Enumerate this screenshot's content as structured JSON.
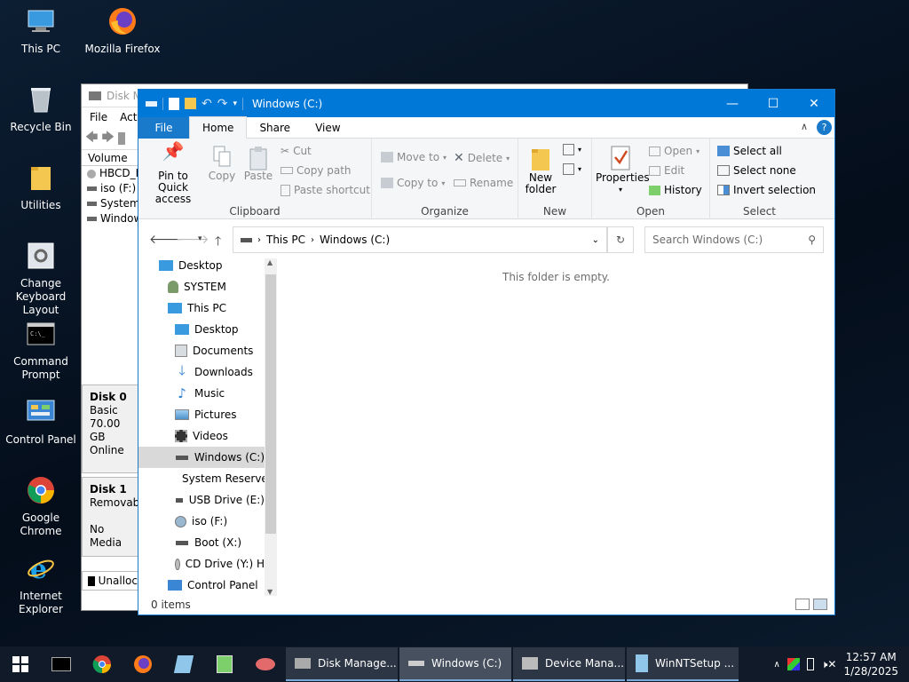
{
  "desktop": {
    "icons": [
      {
        "label": "This PC"
      },
      {
        "label": "Mozilla Firefox"
      },
      {
        "label": "Recycle Bin"
      },
      {
        "label": "Utilities"
      },
      {
        "label": "Change Keyboard Layout"
      },
      {
        "label": "Command Prompt"
      },
      {
        "label": "Control Panel"
      },
      {
        "label": "Google Chrome"
      },
      {
        "label": "Internet Explorer"
      }
    ]
  },
  "bg_window": {
    "title": "Disk Ma",
    "menu": [
      "File",
      "Acti"
    ],
    "column_header": "Volume",
    "volumes": [
      "HBCD_F",
      "iso (F:)",
      "System",
      "Window"
    ],
    "disk0": {
      "name": "Disk 0",
      "type": "Basic",
      "size": "70.00 GB",
      "status": "Online"
    },
    "disk1": {
      "name": "Disk 1",
      "type": "Removabl",
      "status": "No Media"
    },
    "unalloc": "Unalloc"
  },
  "explorer": {
    "title": "Windows (C:)",
    "tabs": {
      "file": "File",
      "home": "Home",
      "share": "Share",
      "view": "View"
    },
    "ribbon": {
      "clipboard": {
        "label": "Clipboard",
        "pin": "Pin to Quick access",
        "copy": "Copy",
        "paste": "Paste",
        "cut": "Cut",
        "copy_path": "Copy path",
        "paste_shortcut": "Paste shortcut"
      },
      "organize": {
        "label": "Organize",
        "move_to": "Move to",
        "copy_to": "Copy to",
        "delete": "Delete",
        "rename": "Rename"
      },
      "new": {
        "label": "New",
        "new_folder": "New folder"
      },
      "open": {
        "label": "Open",
        "properties": "Properties",
        "open": "Open",
        "edit": "Edit",
        "history": "History"
      },
      "select": {
        "label": "Select",
        "select_all": "Select all",
        "select_none": "Select none",
        "invert": "Invert selection"
      }
    },
    "address": {
      "segments": [
        "This PC",
        "Windows (C:)"
      ]
    },
    "search": {
      "placeholder": "Search Windows (C:)"
    },
    "nav": [
      {
        "label": "Desktop"
      },
      {
        "label": "SYSTEM"
      },
      {
        "label": "This PC"
      },
      {
        "label": "Desktop"
      },
      {
        "label": "Documents"
      },
      {
        "label": "Downloads"
      },
      {
        "label": "Music"
      },
      {
        "label": "Pictures"
      },
      {
        "label": "Videos"
      },
      {
        "label": "Windows (C:)"
      },
      {
        "label": "System Reserve"
      },
      {
        "label": "USB Drive (E:)"
      },
      {
        "label": "iso (F:)"
      },
      {
        "label": "Boot (X:)"
      },
      {
        "label": "CD Drive (Y:) H"
      },
      {
        "label": "Control Panel"
      }
    ],
    "empty_message": "This folder is empty.",
    "status": "0 items"
  },
  "taskbar": {
    "buttons": [
      {
        "label": "Disk Manage..."
      },
      {
        "label": "Windows (C:)"
      },
      {
        "label": "Device Mana..."
      },
      {
        "label": "WinNTSetup ..."
      }
    ],
    "time": "12:57 AM",
    "date": "1/28/2025"
  },
  "colors": {
    "accent": "#0078d7",
    "title_text": "#ffffff",
    "nav_selected": "#d9d9d9"
  }
}
